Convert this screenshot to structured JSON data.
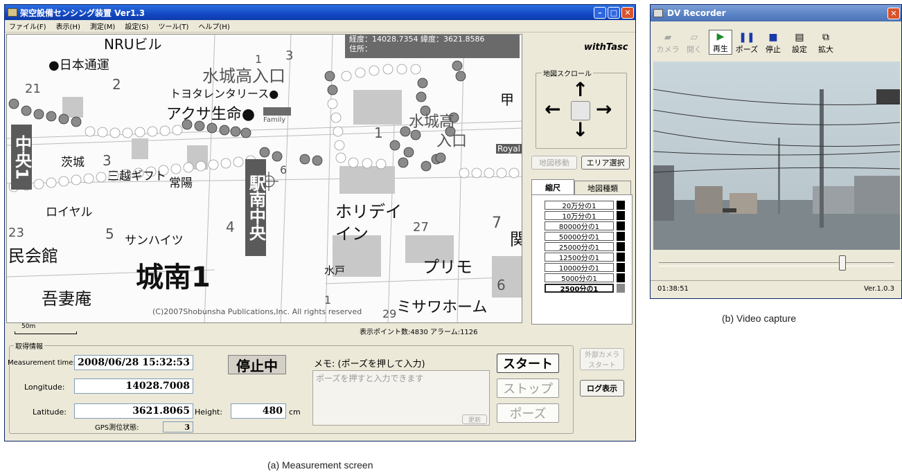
{
  "main_window": {
    "title": "架空設備センシング装置 Ver1.3",
    "menu": [
      "ファイル(F)",
      "表示(H)",
      "測定(M)",
      "設定(S)",
      "ツール(T)",
      "ヘルプ(H)"
    ],
    "map": {
      "gps_readout_line1": "経度：14028.7354 緯度：3621.8586",
      "gps_readout_line2": "住所：",
      "copyright": "(C)2007Shobunsha Publications,Inc. All rights reserved",
      "labels": {
        "nippon_tsuun": "●日本通運",
        "toyota_rent": "トヨタレンタリース●",
        "akusa": "アクサ生命●",
        "family": "Family",
        "mito_koukou": "水城高入口",
        "mito_koukou2": "水城高",
        "nyuguchi": "入口",
        "ibaraki": "茨城",
        "mitsukoshi": "三越ギフト",
        "joyo": "常陽",
        "royal": "ロイヤル",
        "sunheights": "サンハイツ",
        "minkaikan": "民会館",
        "azumaan": "吾妻庵",
        "jonan1": "城南1",
        "holiday": "ホリデイ",
        "inn": "イン",
        "mito": "水戸",
        "primo": "プリモ",
        "misawa": "ミサワホーム",
        "kou": "甲",
        "seki": "関",
        "royal_sign": "Royal",
        "nru": "NRUビル",
        "n21": "21",
        "n2": "2",
        "n3": "3",
        "n1": "1",
        "n4": "4",
        "n5": "5",
        "n6": "6",
        "n7": "7",
        "n23": "23",
        "n27": "27",
        "n29": "29",
        "n3b": "3",
        "n1b": "1",
        "n6b": "6",
        "n1c": "1"
      },
      "banner_left": "中央1",
      "banner_center": "駅南中央"
    },
    "scale_label": "50m",
    "stats": "表示ポイント数:4830 アラーム:1126",
    "right_panel": {
      "logo": "withTasc",
      "scroll_group_title": "地図スクロール",
      "map_move_button": "地図移動",
      "area_select_button": "エリア選択",
      "tabs": [
        "縮尺",
        "地図種類"
      ],
      "scales": [
        "20万分の1",
        "10万分の1",
        "80000分の1",
        "50000分の1",
        "25000分の1",
        "12500分の1",
        "10000分の1",
        "5000分の1",
        "2500分の1"
      ],
      "selected_scale": "2500分の1"
    },
    "info": {
      "group_title": "取得情報",
      "measurement_time_label": "Measurement time:",
      "measurement_time": "2008/06/28 15:32:53",
      "longitude_label": "Longitude:",
      "longitude": "14028.7008",
      "latitude_label": "Latitude:",
      "latitude": "3621.8065",
      "height_label": "Height:",
      "height": "480",
      "height_unit": "cm",
      "gps_status_label": "GPS測位状態:",
      "gps_status": "3",
      "status": "停止中",
      "memo_label": "メモ: (ポーズを押して入力)",
      "memo_placeholder": "ポーズを押すと入力できます",
      "update_button": "更新",
      "start_button": "スタート",
      "stop_button": "ストップ",
      "pause_button": "ポーズ",
      "ext_camera_button_line1": "外部カメラ",
      "ext_camera_button_line2": "スタート",
      "log_button": "ログ表示"
    }
  },
  "dv_window": {
    "title": "DV Recorder",
    "toolbar": [
      {
        "label": "カメラ",
        "icon": "camera-icon",
        "glyph": "▰",
        "state": "disabled"
      },
      {
        "label": "開く",
        "icon": "open-icon",
        "glyph": "▱",
        "state": "disabled"
      },
      {
        "label": "再生",
        "icon": "play-icon",
        "glyph": "▶",
        "state": "active"
      },
      {
        "label": "ポーズ",
        "icon": "pause-icon",
        "glyph": "❚❚",
        "state": "normal"
      },
      {
        "label": "停止",
        "icon": "stop-icon",
        "glyph": "■",
        "state": "normal"
      },
      {
        "label": "設定",
        "icon": "settings-icon",
        "glyph": "▤",
        "state": "normal"
      },
      {
        "label": "拡大",
        "icon": "zoom-icon",
        "glyph": "⧉",
        "state": "normal"
      }
    ],
    "playback_position": 0.78,
    "time": "01:38:51",
    "version": "Ver.1.0.3"
  },
  "captions": {
    "a": "(a) Measurement screen",
    "b": "(b) Video capture"
  }
}
